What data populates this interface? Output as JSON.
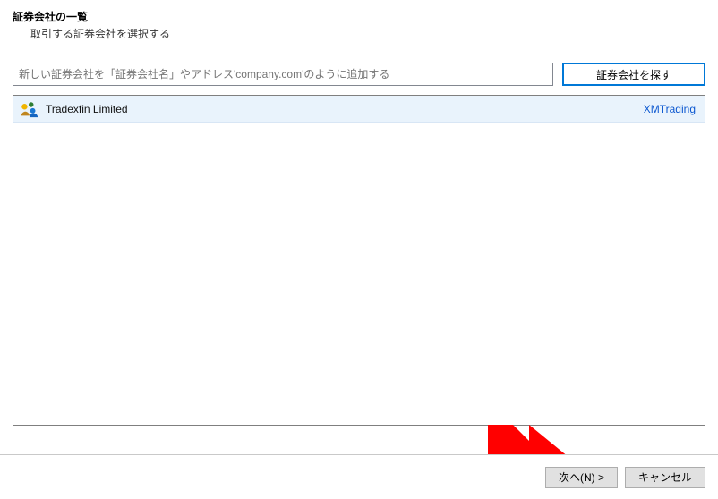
{
  "header": {
    "title": "証券会社の一覧",
    "subtitle": "取引する証券会社を選択する"
  },
  "search": {
    "placeholder": "新しい証券会社を「証券会社名」やアドレス'company.com'のように追加する",
    "button": "証券会社を探す"
  },
  "brokers": [
    {
      "name": "Tradexfin Limited",
      "link_label": "XMTrading",
      "icon": "broker-icon"
    }
  ],
  "footer": {
    "next": "次へ(N) >",
    "cancel": "キャンセル"
  }
}
